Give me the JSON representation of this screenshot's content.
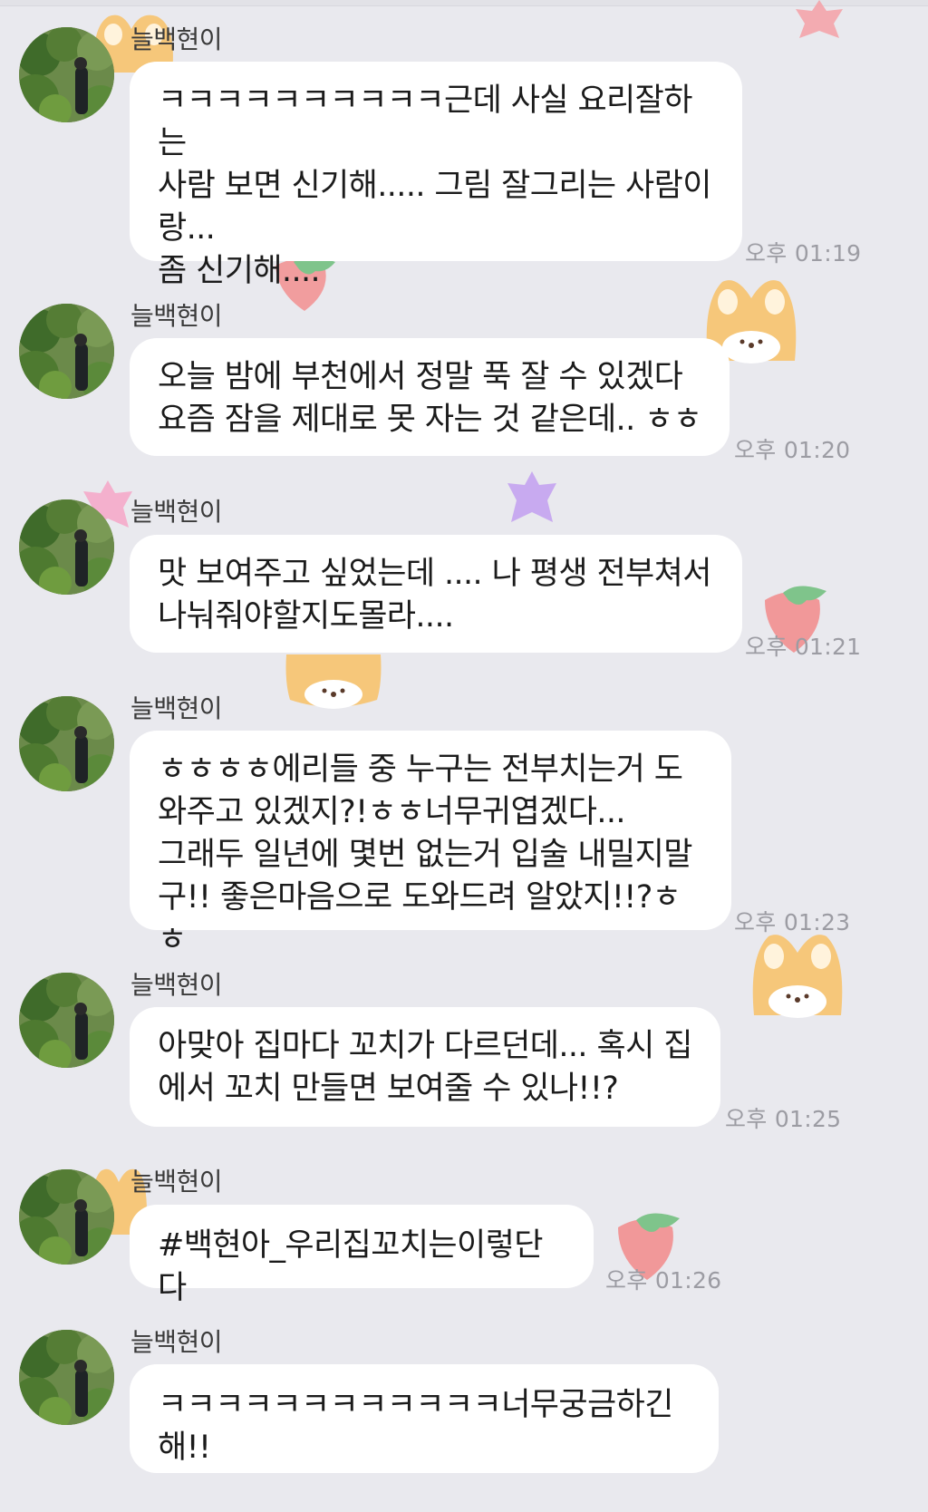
{
  "chat": {
    "messages": [
      {
        "sender": "늘백현이",
        "text": "ㅋㅋㅋㅋㅋㅋㅋㅋㅋㅋ근데 사실 요리잘하는\n사람 보면 신기해..... 그림 잘그리는 사람이\n랑...\n좀 신기해....",
        "time": "오후 01:19",
        "avatar": "profile-photo-garden"
      },
      {
        "sender": "늘백현이",
        "text": "오늘 밤에 부천에서 정말 푹 잘 수 있겠다\n요즘 잠을 제대로 못 자는 것 같은데.. ㅎㅎ",
        "time": "오후 01:20",
        "avatar": "profile-photo-garden"
      },
      {
        "sender": "늘백현이",
        "text": "맛 보여주고 싶었는데 .... 나 평생 전부쳐서\n나눠줘야할지도몰라....",
        "time": "오후 01:21",
        "avatar": "profile-photo-garden"
      },
      {
        "sender": "늘백현이",
        "text": "ㅎㅎㅎㅎ에리들 중 누구는 전부치는거 도\n와주고 있겠지?!ㅎㅎ너무귀엽겠다...\n그래두 일년에 몇번 없는거 입술 내밀지말\n구!! 좋은마음으로 도와드려 알았지!!?ㅎㅎ",
        "time": "오후 01:23",
        "avatar": "profile-photo-garden"
      },
      {
        "sender": "늘백현이",
        "text": "아맞아 집마다 꼬치가 다르던데... 혹시 집\n에서 꼬치 만들면 보여줄 수 있나!!?",
        "time": "오후 01:25",
        "avatar": "profile-photo-garden"
      },
      {
        "sender": "늘백현이",
        "text": "#백현아_우리집꼬치는이렇단다",
        "time": "오후 01:26",
        "avatar": "profile-photo-garden"
      },
      {
        "sender": "늘백현이",
        "text": "ㅋㅋㅋㅋㅋㅋㅋㅋㅋㅋㅋㅋ너무궁금하긴해!!",
        "time": "",
        "avatar": "profile-photo-garden"
      }
    ]
  },
  "theme": {
    "background": "#e9e9ee",
    "bubble": "#ffffff",
    "text": "#1b1b1b",
    "time": "#9c9ca3",
    "stickers": [
      "strawberry-icon",
      "fox-face-icon",
      "star-icon"
    ]
  }
}
